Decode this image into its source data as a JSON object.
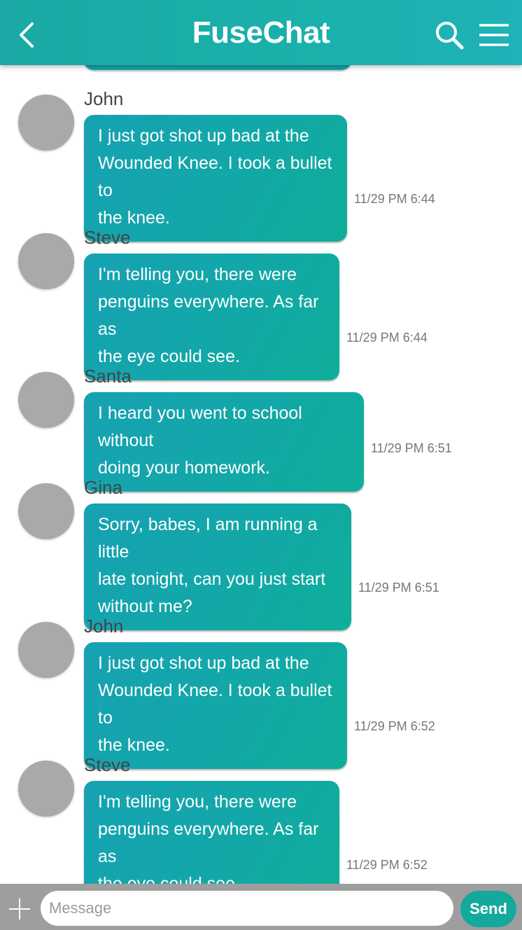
{
  "header": {
    "title": "FuseChat",
    "back_icon": "chevron-left-icon",
    "search_icon": "search-icon",
    "menu_icon": "hamburger-menu-icon",
    "color": "#1ab1ab"
  },
  "messages": [
    {
      "sender": "John",
      "lines": [
        "I just got shot up bad at the",
        "Wounded Knee. I took a bullet to",
        "the knee."
      ],
      "time": "11/29 PM 6:44"
    },
    {
      "sender": "Steve",
      "lines": [
        "I'm telling you, there were",
        "penguins everywhere. As far as",
        "the eye could see."
      ],
      "time": "11/29 PM 6:44"
    },
    {
      "sender": "Santa",
      "lines": [
        "I heard you went to school without",
        "doing your homework."
      ],
      "time": "11/29 PM 6:51"
    },
    {
      "sender": "Gina",
      "lines": [
        "Sorry, babes, I am running a little",
        "late tonight, can you just start",
        "without me?"
      ],
      "time": "11/29 PM 6:51"
    },
    {
      "sender": "John",
      "lines": [
        "I just got shot up bad at the",
        "Wounded Knee. I took a bullet to",
        "the knee."
      ],
      "time": "11/29 PM 6:52"
    },
    {
      "sender": "Steve",
      "lines": [
        "I'm telling you, there were",
        "penguins everywhere. As far as",
        "the eye could see."
      ],
      "time": "11/29 PM 6:52"
    }
  ],
  "composer": {
    "placeholder": "Message",
    "value": "",
    "send_label": "Send",
    "add_icon": "plus-icon"
  },
  "colors": {
    "bubble": "#12a8a6",
    "avatar": "#a9a9a9",
    "composer_bar": "#9e9e9e",
    "send_button": "#15a99c"
  }
}
